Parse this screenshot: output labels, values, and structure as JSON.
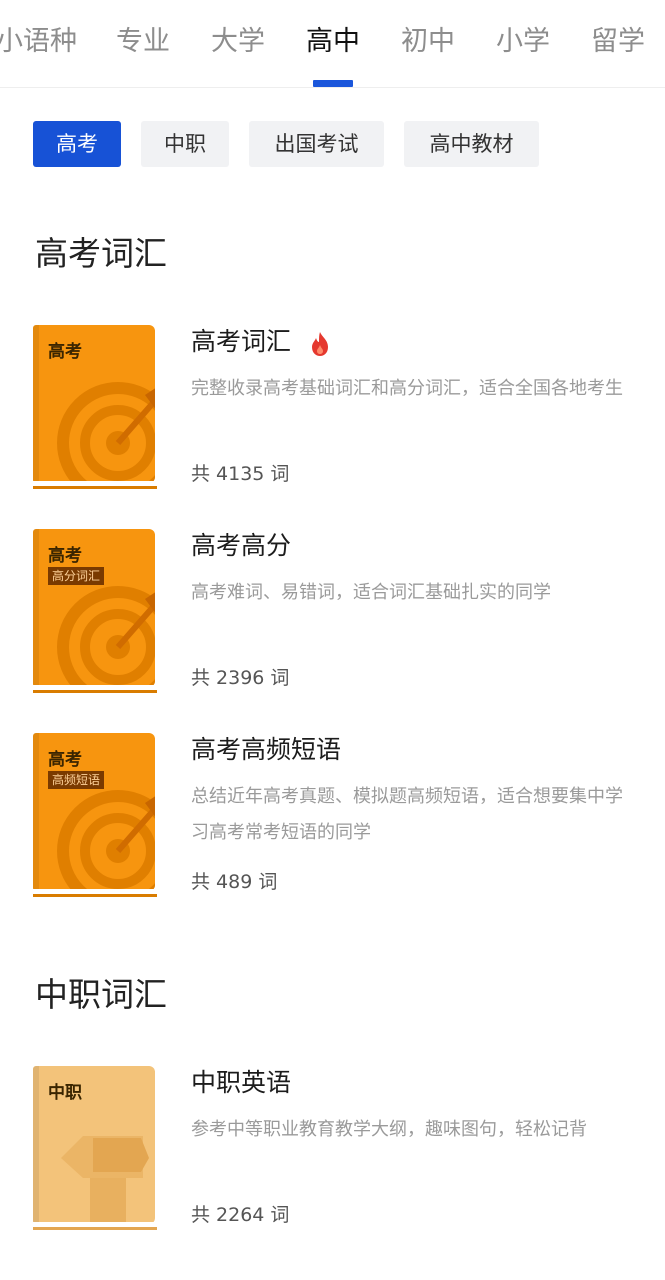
{
  "top_tabs": [
    "小语种",
    "专业",
    "大学",
    "高中",
    "初中",
    "小学",
    "留学"
  ],
  "active_tab": "高中",
  "chips": [
    "高考",
    "中职",
    "出国考试",
    "高中教材"
  ],
  "active_chip": "高考",
  "sections": [
    {
      "title": "高考词汇",
      "books": [
        {
          "cover_title": "高考",
          "cover_tag": "",
          "title": "高考词汇",
          "hot_icon": "fire-icon",
          "desc": "完整收录高考基础词汇和高分词汇，适合全国各地考生",
          "count": "共 4135 词"
        },
        {
          "cover_title": "高考",
          "cover_tag": "高分词汇",
          "title": "高考高分",
          "desc": "高考难词、易错词，适合词汇基础扎实的同学",
          "count": "共 2396 词"
        },
        {
          "cover_title": "高考",
          "cover_tag": "高频短语",
          "title": "高考高频短语",
          "desc": "总结近年高考真题、模拟题高频短语，适合想要集中学习高考常考短语的同学",
          "count": "共 489 词"
        }
      ]
    },
    {
      "title": "中职词汇",
      "books": [
        {
          "cover_title": "中职",
          "cover_tag": "",
          "title": "中职英语",
          "desc": "参考中等职业教育教学大纲，趣味图句，轻松记背",
          "count": "共 2264 词"
        }
      ]
    }
  ],
  "colors": {
    "accent": "#1752d6",
    "orange_cover": "#f7950f",
    "light_cover": "#f3c37a",
    "fire": "#e5392f"
  }
}
